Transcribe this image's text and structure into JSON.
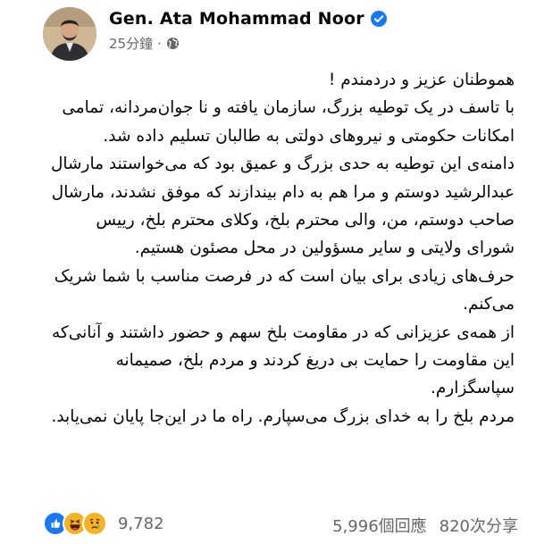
{
  "post": {
    "author": "Gen. Ata Mohammad Noor",
    "timestamp": "25分鐘",
    "separator": "·",
    "audience_icon": "globe-icon",
    "verified_icon": "verified-badge-icon",
    "paragraphs": [
      "هموطنان عزیز و دردمندم !",
      "با تاسف در یک توطیه بزرگ، سازمان یافته و نا جوان‌مردانه، تمامی امکانات حکومتی و نیروهای دولتی به طالبان تسلیم داده شد.",
      "دامنه‌ی این توطیه به حدی بزرگ و عمیق بود که می‌خواستند مارشال عبدالرشید دوستم و مرا هم به دام بیندازند که موفق نشدند، مارشال صاحب دوستم، من، والی محترم بلخ، وکلای محترم بلخ، رییس شورای ولایتی و سایر مسؤولین در محل مصئون هستیم.",
      "حرف‌های زیادی برای بیان است که در فرصت مناسب با شما شریک می‌کنم.",
      "از همه‌ی عزیزانی که در مقاومت بلخ سهم و حضور داشتند و آنانی‌که این مقاومت را حمایت بی دریغ کردند و مردم بلخ، صمیمانه سپاسگزارم.",
      "مردم بلخ را به خدای بزرگ می‌سپارم. راه ما در این‌جا پایان نمی‌یابد."
    ]
  },
  "footer": {
    "reaction_icons": [
      "like-icon",
      "haha-icon",
      "sad-icon"
    ],
    "reaction_count": "9,782",
    "comments": "5,996個回應",
    "shares": "820次分享"
  },
  "colors": {
    "facebook_blue": "#1877f2",
    "secondary_text": "#65676b",
    "reaction_yellow": "#f7b125"
  }
}
